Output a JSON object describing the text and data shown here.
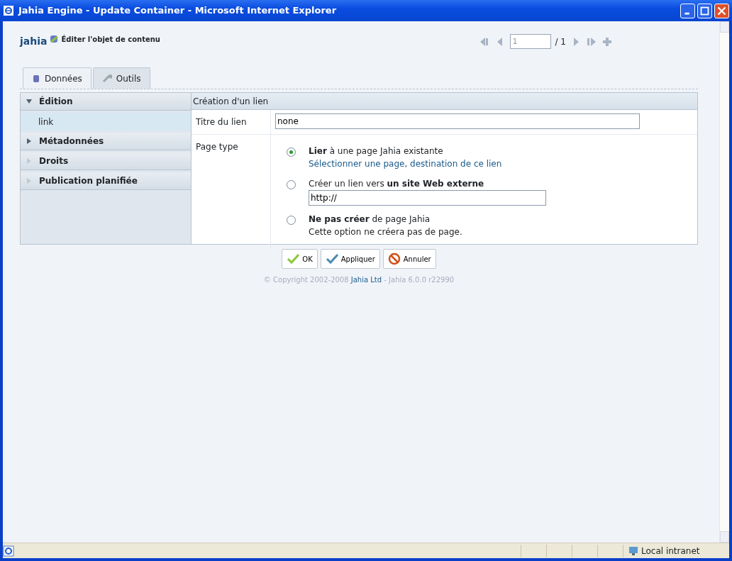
{
  "window": {
    "title": "Jahia Engine - Update Container - Microsoft Internet Explorer"
  },
  "header": {
    "title": "Éditer l'objet de contenu",
    "logo": "jahia"
  },
  "pager": {
    "page": "1",
    "total": "/ 1"
  },
  "tabs": [
    {
      "label": "Données",
      "selected": true
    },
    {
      "label": "Outils",
      "selected": false
    }
  ],
  "sidebar": {
    "items": [
      {
        "label": "Édition",
        "expanded": true,
        "disabled": false,
        "children": [
          {
            "label": "link",
            "selected": true
          }
        ]
      },
      {
        "label": "Métadonnées",
        "expanded": false,
        "disabled": false
      },
      {
        "label": "Droits",
        "expanded": false,
        "disabled": true
      },
      {
        "label": "Publication planifiée",
        "expanded": false,
        "disabled": true
      }
    ]
  },
  "form": {
    "title": "Création d'un lien",
    "title_field": {
      "label": "Titre du lien",
      "value": "none"
    },
    "page_type": {
      "label": "Page type",
      "options": [
        {
          "text": "**Lier** à une page Jahia existante",
          "selected": true,
          "kind": "link",
          "detail": "Sélectionner une page, destination de ce lien"
        },
        {
          "text": "Créer un lien vers **un site Web externe**",
          "selected": false,
          "kind": "input",
          "detail": "http://"
        },
        {
          "text": "**Ne pas créer** de page Jahia",
          "selected": false,
          "kind": "text",
          "detail": "Cette option ne créera pas de page."
        }
      ]
    }
  },
  "buttons": [
    {
      "label": "OK",
      "kind": "ok"
    },
    {
      "label": "Appliquer",
      "kind": "apply"
    },
    {
      "label": "Annuler",
      "kind": "cancel"
    }
  ],
  "footer": {
    "before": "© Copyright 2002-2008 ",
    "link": "Jahia Ltd",
    "after": " - Jahia 6.0.0 r22990"
  },
  "status_bar": {
    "zone": "Local intranet"
  }
}
